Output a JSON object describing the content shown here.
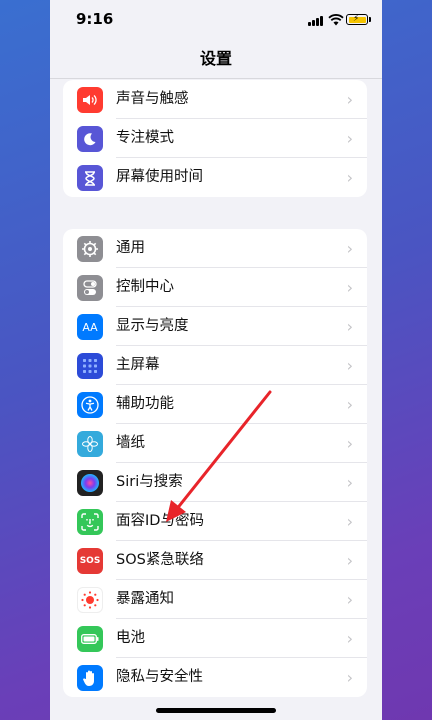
{
  "status_bar": {
    "time": "9:16"
  },
  "nav": {
    "title": "设置"
  },
  "group1": [
    {
      "id": "sounds",
      "label": "声音与触感",
      "icon": "speaker-icon",
      "color": "#ff3b30"
    },
    {
      "id": "focus",
      "label": "专注模式",
      "icon": "moon-icon",
      "color": "#5856d6"
    },
    {
      "id": "screen-time",
      "label": "屏幕使用时间",
      "icon": "hourglass-icon",
      "color": "#5856d6"
    }
  ],
  "group2": [
    {
      "id": "general",
      "label": "通用",
      "icon": "gear-icon",
      "color": "#8e8e93"
    },
    {
      "id": "control-center",
      "label": "控制中心",
      "icon": "toggle-icon",
      "color": "#8e8e93"
    },
    {
      "id": "display",
      "label": "显示与亮度",
      "icon": "text-size-icon",
      "color": "#007aff",
      "glyph": "AA"
    },
    {
      "id": "home-screen",
      "label": "主屏幕",
      "icon": "app-grid-icon",
      "color": "#2c4bd8"
    },
    {
      "id": "accessibility",
      "label": "辅助功能",
      "icon": "accessibility-icon",
      "color": "#007aff"
    },
    {
      "id": "wallpaper",
      "label": "墙纸",
      "icon": "flower-icon",
      "color": "#34aadc"
    },
    {
      "id": "siri",
      "label": "Siri与搜索",
      "icon": "siri-icon",
      "color": "#222222"
    },
    {
      "id": "face-id",
      "label": "面容ID与密码",
      "icon": "face-id-icon",
      "color": "#34c759"
    },
    {
      "id": "sos",
      "label": "SOS紧急联络",
      "icon": "sos-icon",
      "color": "#e53935",
      "glyph": "SOS"
    },
    {
      "id": "exposure",
      "label": "暴露通知",
      "icon": "exposure-icon",
      "color": "#ffffff"
    },
    {
      "id": "battery",
      "label": "电池",
      "icon": "battery-icon",
      "color": "#34c759"
    },
    {
      "id": "privacy",
      "label": "隐私与安全性",
      "icon": "hand-icon",
      "color": "#007aff"
    }
  ]
}
